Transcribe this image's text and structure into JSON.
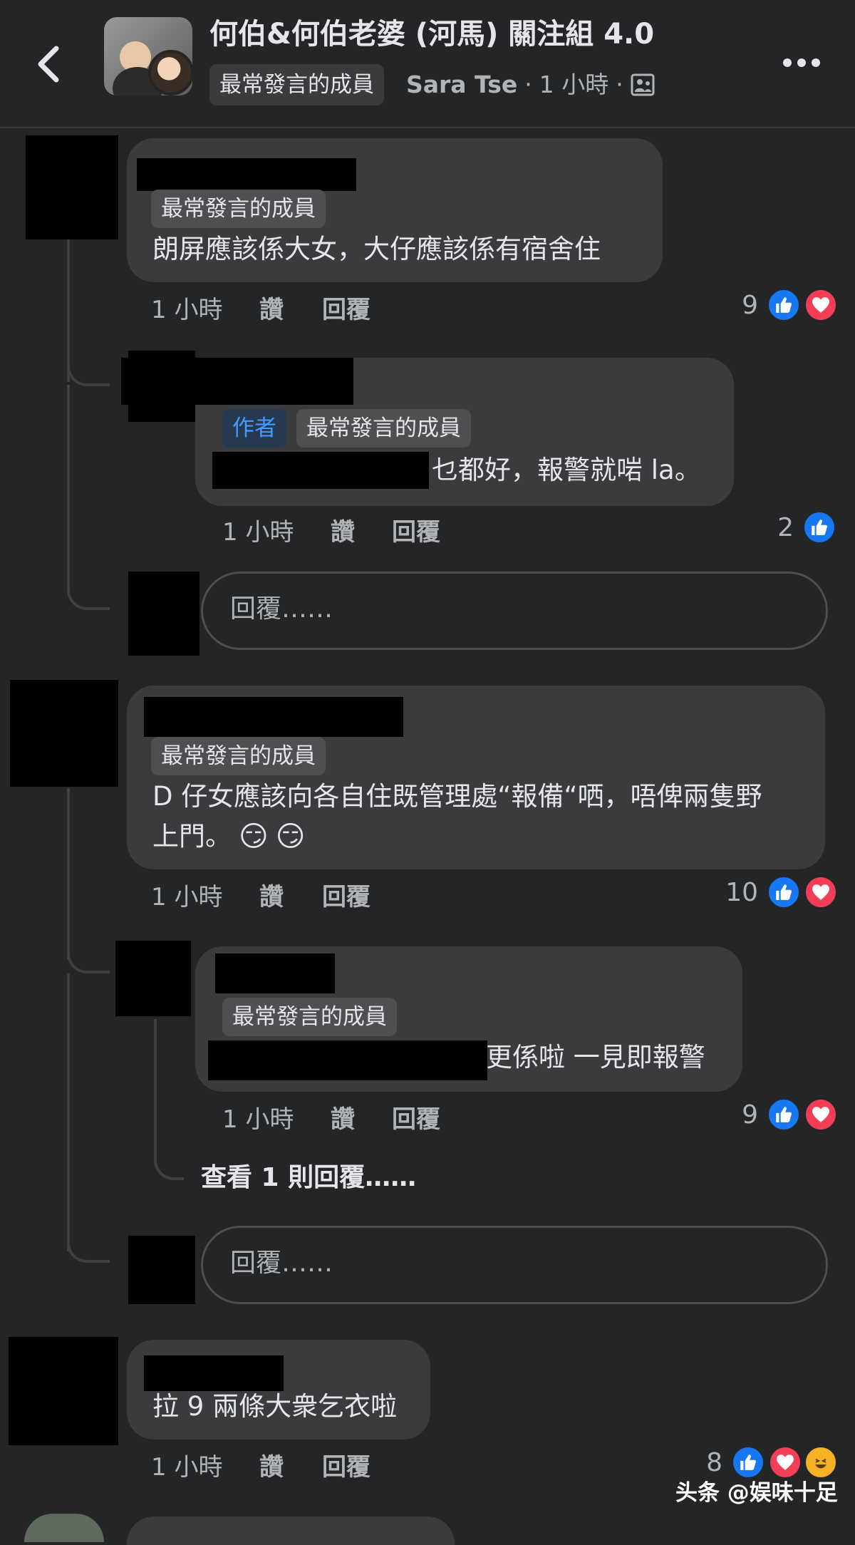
{
  "header": {
    "group_title": "何伯&何伯老婆 (河馬) 關注組 4.0",
    "top_badge": "最常發言的成員",
    "author_name": "Sara Tse",
    "separator": "·",
    "post_time": "1 小時",
    "privacy_icon": "group-members-icon"
  },
  "comments": [
    {
      "badges": [
        "最常發言的成員"
      ],
      "text": "朗屏應該係大女，大仔應該係有宿舍住",
      "time": "1 小時",
      "like_label": "讚",
      "reply_label": "回覆",
      "reaction_count": "9",
      "reactions": [
        "like",
        "love"
      ]
    },
    {
      "badges": [
        "作者",
        "最常發言的成員"
      ],
      "text": "乜都好，報警就啱 la。",
      "time": "1 小時",
      "like_label": "讚",
      "reply_label": "回覆",
      "reaction_count": "2",
      "reactions": [
        "like"
      ]
    },
    {
      "badges": [
        "最常發言的成員"
      ],
      "text_line1": "D 仔女應該向各自住既管理處“報備“哂，唔俾兩隻野",
      "text_line2": "上門。",
      "emoji": "😏",
      "time": "1 小時",
      "like_label": "讚",
      "reply_label": "回覆",
      "reaction_count": "10",
      "reactions": [
        "like",
        "love"
      ]
    },
    {
      "badges": [
        "最常發言的成員"
      ],
      "text": "更係啦 一見即報警",
      "time": "1 小時",
      "like_label": "讚",
      "reply_label": "回覆",
      "reaction_count": "9",
      "reactions": [
        "like",
        "love"
      ],
      "view_replies": "查看 1 則回覆……"
    },
    {
      "badges": [],
      "text": "拉 9 兩條大衆乞衣啦",
      "time": "1 小時",
      "like_label": "讚",
      "reply_label": "回覆",
      "reaction_count": "8",
      "reactions": [
        "like",
        "love",
        "haha"
      ]
    }
  ],
  "reply_input": {
    "placeholder": "回覆……"
  },
  "watermark": "头条 @娱味十足",
  "colors": {
    "background": "#242526",
    "bubble": "#3a3b3c",
    "like_blue": "#1877f2",
    "love_red": "#f33e58",
    "author_badge_text": "#4599ff"
  }
}
